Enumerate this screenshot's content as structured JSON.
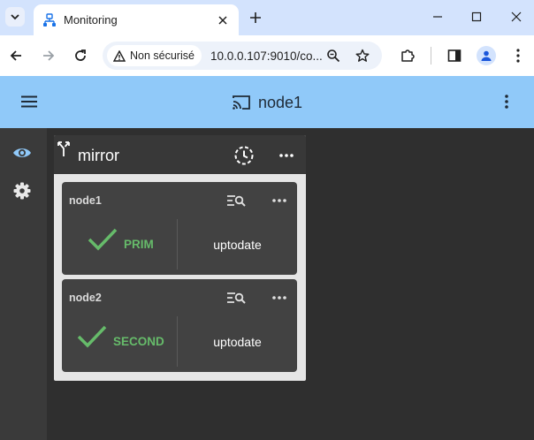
{
  "browser": {
    "tab_title": "Monitoring",
    "security_label": "Non sécurisé",
    "url": "10.0.0.107:9010/co..."
  },
  "appbar": {
    "title": "node1",
    "color": "#90c9f9"
  },
  "panel": {
    "title": "mirror",
    "cards": [
      {
        "name": "node1",
        "role": "PRIM",
        "status": "uptodate"
      },
      {
        "name": "node2",
        "role": "SECOND",
        "status": "uptodate"
      }
    ]
  },
  "colors": {
    "ok_green": "#66bb6a",
    "rail_active": "#90c9f9"
  },
  "icons": {
    "rail": [
      "eye-icon",
      "gear-icon"
    ],
    "panel_header": [
      "fork-icon",
      "history-icon",
      "more-horiz-icon"
    ],
    "card": [
      "search-list-icon",
      "more-horiz-icon",
      "check-icon"
    ]
  }
}
